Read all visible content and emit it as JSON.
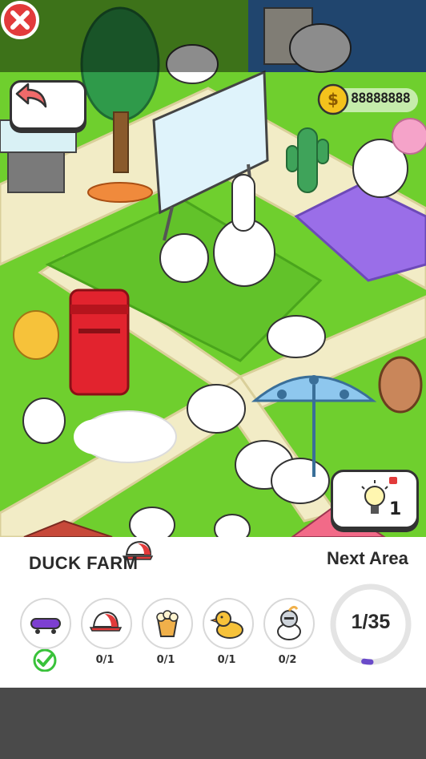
{
  "header": {
    "coins": "88888888"
  },
  "hint": {
    "count": "1"
  },
  "level": {
    "title": "DUCK FARM",
    "next_label": "Next Area"
  },
  "progress": {
    "text": "1/35",
    "found": 1,
    "total": 35
  },
  "targets": [
    {
      "icon": "skateboard-icon",
      "count": "",
      "done": true
    },
    {
      "icon": "cap-icon",
      "count": "0/1"
    },
    {
      "icon": "popcorn-icon",
      "count": "0/1"
    },
    {
      "icon": "rubber-duck-icon",
      "count": "0/1"
    },
    {
      "icon": "knight-duck-icon",
      "count": "0/2"
    }
  ],
  "colors": {
    "grass": "#6fcf2e",
    "path": "#f2ecc6",
    "panel": "#ffffff",
    "accent": "#6a4bc9",
    "check": "#39c23a",
    "wrong": "#e23b3b"
  }
}
